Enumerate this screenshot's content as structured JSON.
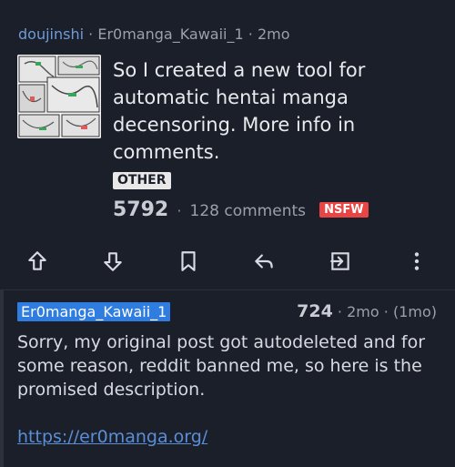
{
  "post": {
    "subreddit": "doujinshi",
    "separator": "·",
    "author": "Er0manga_Kawaii_1",
    "age": "2mo",
    "title": "So I created a new tool for automatic hentai manga decensoring. More info in comments.",
    "flair": "OTHER",
    "score": "5792",
    "comments": "128 comments",
    "nsfw_tag": "NSFW"
  },
  "actions": {
    "icons": [
      "upvote-icon",
      "downvote-icon",
      "bookmark-icon",
      "reply-icon",
      "share-icon",
      "more-icon"
    ]
  },
  "comment": {
    "author": "Er0manga_Kawaii_1",
    "score": "724",
    "age": "2mo",
    "edited": "(1mo)",
    "body": "Sorry, my original post got autodeleted and for some reason, reddit banned me, so here is the promised description.",
    "link": "https://er0manga.org/"
  },
  "colors": {
    "background": "#1b1f29",
    "accent": "#2f7de1",
    "link": "#5a8ed6",
    "nsfw": "#e84545"
  }
}
